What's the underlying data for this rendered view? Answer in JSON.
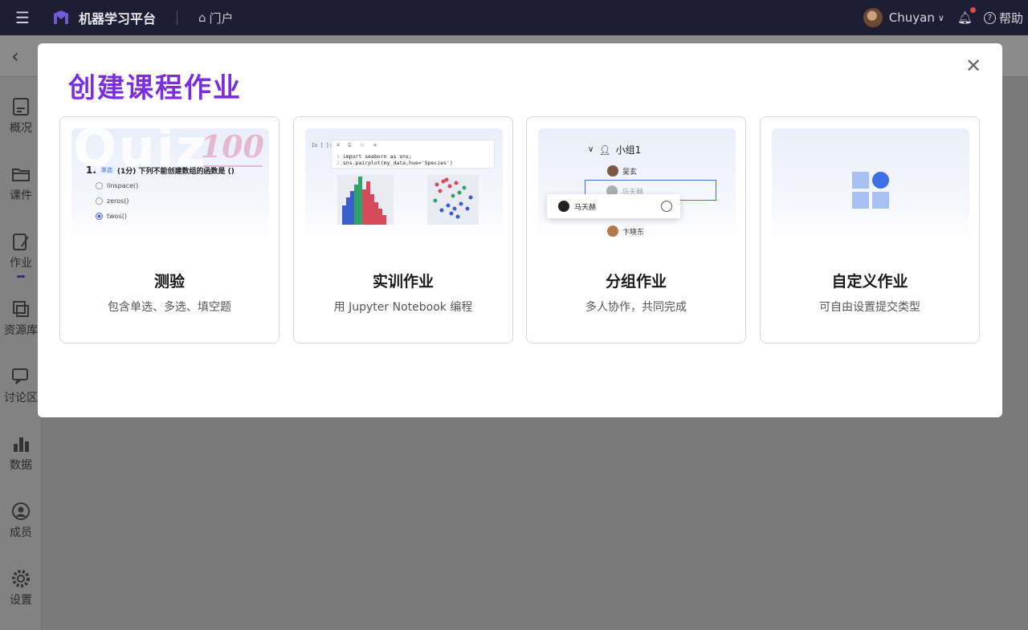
{
  "topbar": {
    "app_title": "机器学习平台",
    "portal_label": "门户",
    "user_name": "Chuyan",
    "help_label": "帮助"
  },
  "sidebar": {
    "items": [
      {
        "label": "概况",
        "icon": "overview-icon"
      },
      {
        "label": "课件",
        "icon": "folder-icon"
      },
      {
        "label": "作业",
        "icon": "assignment-icon",
        "active": true
      },
      {
        "label": "资源库",
        "icon": "resource-icon"
      },
      {
        "label": "讨论区",
        "icon": "discussion-icon"
      },
      {
        "label": "数据",
        "icon": "data-icon"
      },
      {
        "label": "成员",
        "icon": "members-icon"
      },
      {
        "label": "设置",
        "icon": "settings-icon"
      }
    ]
  },
  "modal": {
    "title": "创建课程作业",
    "cards": [
      {
        "name": "测验",
        "desc": "包含单选、多选、填空题",
        "preview": {
          "bg_word": "Quiz",
          "score": "100",
          "q_num": "1.",
          "q_tag": "单选",
          "q_text": "(1分) 下列不能创建数组的函数是 ()",
          "options": [
            "linspace()",
            "zeros()",
            "twos()"
          ]
        }
      },
      {
        "name": "实训作业",
        "desc": "用 Jupyter Notebook 编程",
        "preview": {
          "prompt": "In [ ]:",
          "code_line1": "import seaborn as sns;",
          "code_line2": "sns.pairplot(my_data,hue='Species')"
        }
      },
      {
        "name": "分组作业",
        "desc": "多人协作，共同完成",
        "preview": {
          "group_name": "小组1",
          "members": [
            "吴玄",
            "马天赫",
            "卞晓东"
          ],
          "dragging": "马天赫"
        }
      },
      {
        "name": "自定义作业",
        "desc": "可自由设置提交类型"
      }
    ]
  },
  "colors": {
    "accent_purple": "#7b2ee0",
    "topbar_bg": "#1f1d33",
    "primary_blue": "#3d6fe8"
  }
}
